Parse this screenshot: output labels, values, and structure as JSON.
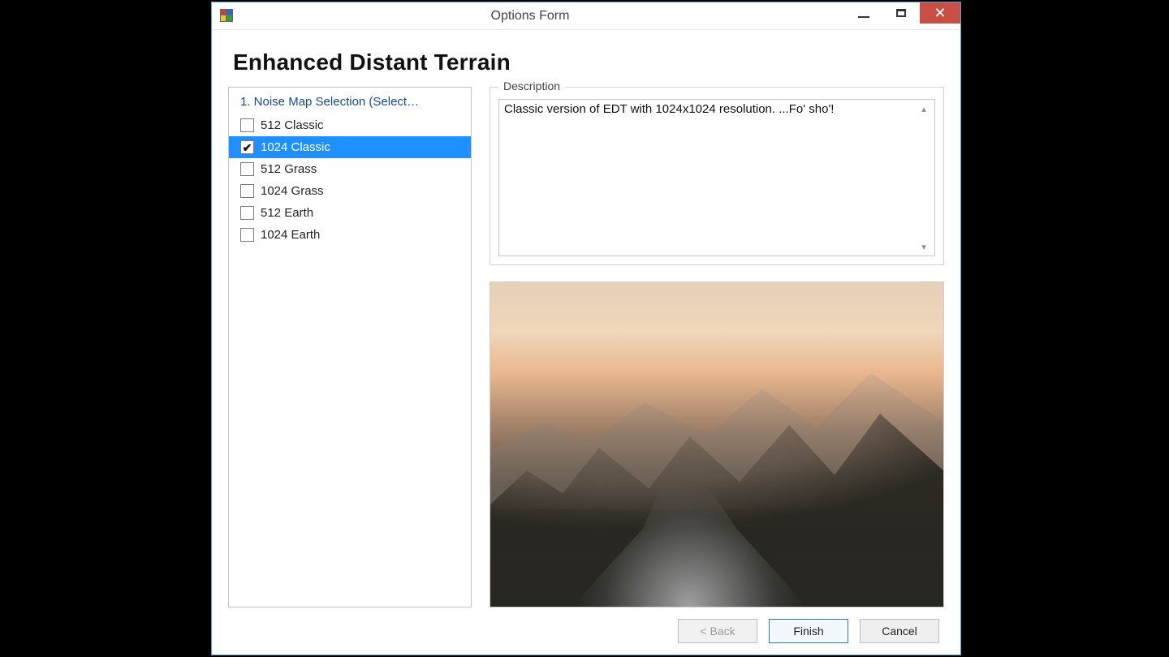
{
  "window": {
    "title": "Options Form"
  },
  "heading": "Enhanced Distant Terrain",
  "section": {
    "header": "1. Noise Map Selection (Select…",
    "options": [
      {
        "label": "512 Classic",
        "checked": false,
        "selected": false
      },
      {
        "label": "1024 Classic",
        "checked": true,
        "selected": true
      },
      {
        "label": "512 Grass",
        "checked": false,
        "selected": false
      },
      {
        "label": "1024 Grass",
        "checked": false,
        "selected": false
      },
      {
        "label": "512 Earth",
        "checked": false,
        "selected": false
      },
      {
        "label": "1024 Earth",
        "checked": false,
        "selected": false
      }
    ]
  },
  "description": {
    "legend": "Description",
    "text": "Classic version of EDT with 1024x1024 resolution. ...Fo' sho'!"
  },
  "preview": {
    "alt": "terrain-preview"
  },
  "buttons": {
    "back": "< Back",
    "finish": "Finish",
    "cancel": "Cancel"
  }
}
